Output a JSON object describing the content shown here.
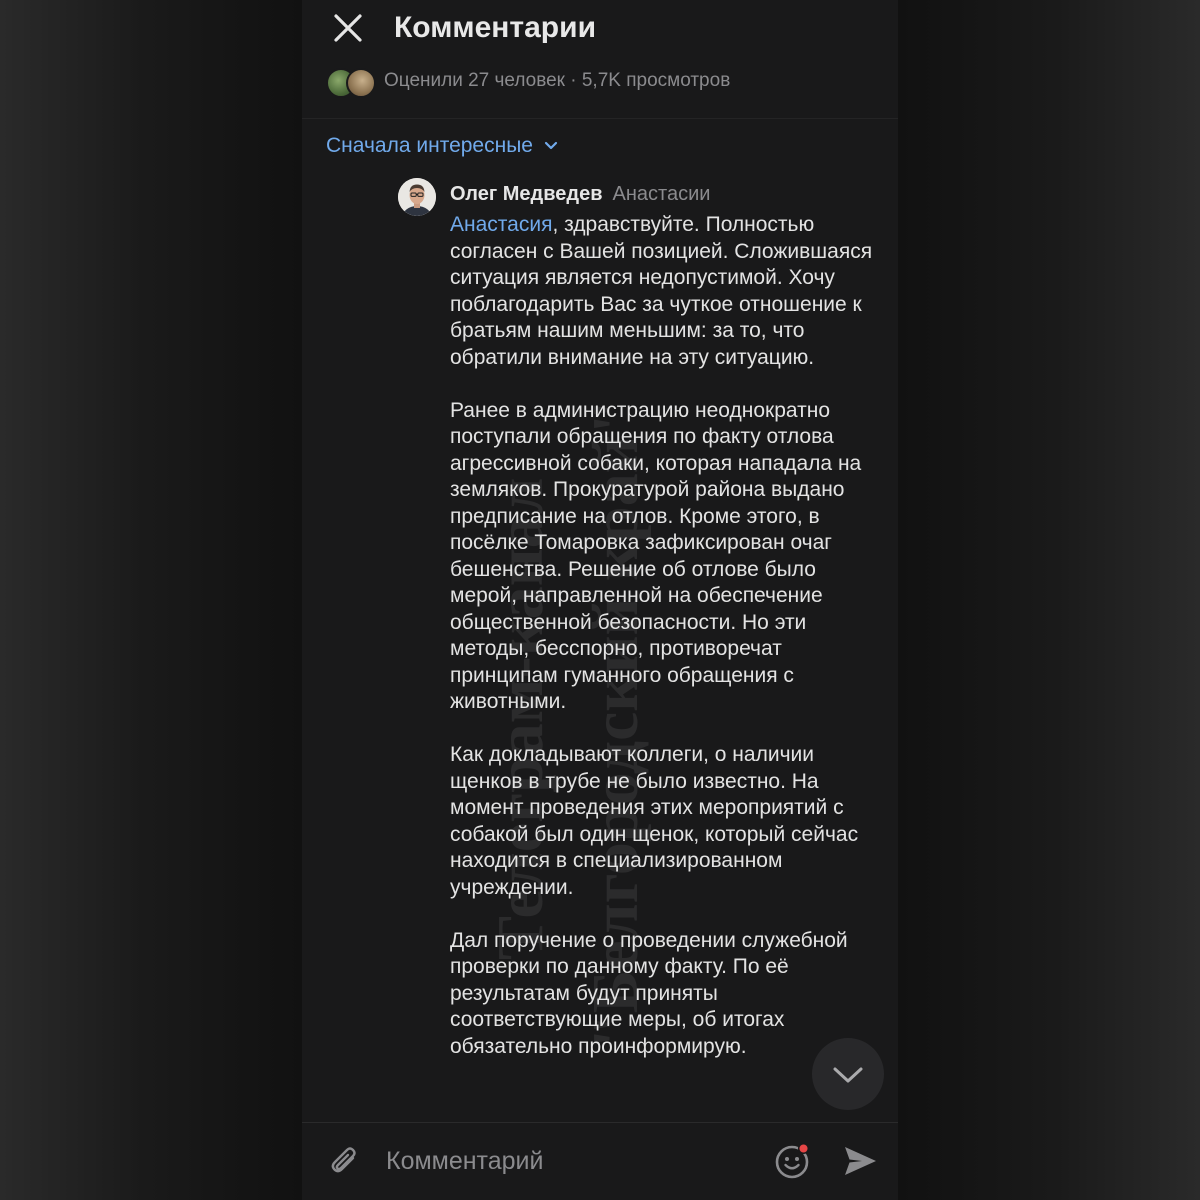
{
  "header": {
    "title": "Комментарии",
    "stats": "Оценили 27 человек · 5,7K просмотров"
  },
  "sort": {
    "label": "Сначала интересные"
  },
  "comment": {
    "author": "Олег Медведев",
    "reply_to": "Анастасии",
    "mention": "Анастасия",
    "first_line_rest": ", здравствуйте. Полностью согласен с Вашей позицией. Сложившаяся ситуация является недопустимой. Хочу поблагодарить Вас за чуткое отношение к братьям нашим меньшим: за то, что обратили внимание на эту ситуацию.",
    "paragraphs": [
      "Ранее в администрацию неоднократно поступали обращения по факту отлова агрессивной собаки, которая нападала на земляков. Прокуратурой района выдано предписание на отлов. Кроме этого, в посёлке Томаровка зафиксирован очаг бешенства. Решение об отлове было мерой, направленной на обеспечение общественной безопасности. Но эти методы, бесспорно, противоречат принципам гуманного обращения с животными.",
      "Как докладывают коллеги, о наличии щенков в трубе не было известно. На момент проведения этих мероприятий с собакой был один щенок, который сейчас находится в специализированном учреждении.",
      "Дал поручение о проведении служебной проверки по данному факту. По её результатам будут приняты соответствующие меры, об итогах обязательно проинформирую."
    ]
  },
  "watermark": {
    "line1": "Телеграм-канал",
    "line2": "\"Белгородский край\""
  },
  "composer": {
    "placeholder": "Комментарий"
  },
  "colors": {
    "background": "#19191a",
    "accent": "#71aaeb",
    "text": "#e3e3e3",
    "secondary": "#8b8b8e",
    "notification_dot": "#e64646"
  },
  "icons": [
    "close-icon",
    "chevron-down-icon",
    "paperclip-icon",
    "emoji-icon",
    "send-icon"
  ]
}
